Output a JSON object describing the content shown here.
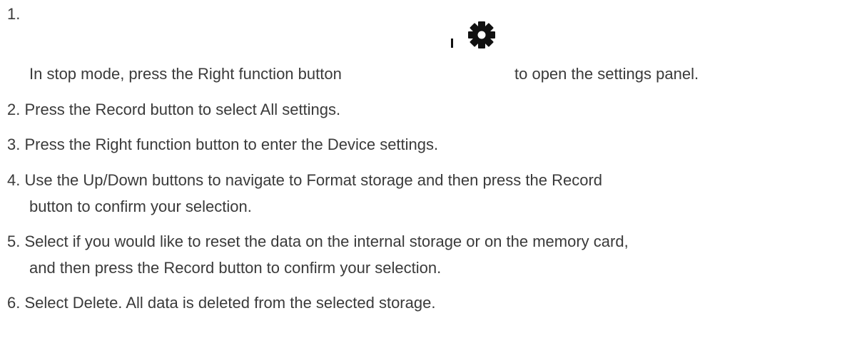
{
  "steps": [
    {
      "number": "1.",
      "text_before_icon": "In stop mode, press the Right function button",
      "icon": "gear-icon",
      "text_after_icon": "to open the settings panel."
    },
    {
      "line1": "2. Press the Record button to select All settings."
    },
    {
      "line1": "3. Press the Right function button to enter the Device settings."
    },
    {
      "line1": "4. Use the Up/Down buttons to navigate to Format storage and then press the Record",
      "line2": "button to confirm your selection."
    },
    {
      "line1": "5. Select if you would like to reset the data on the internal storage or on the memory card,",
      "line2": "and then press the Record button to confirm your selection."
    },
    {
      "line1": "6. Select Delete. All data is deleted from the selected storage."
    }
  ],
  "colors": {
    "text": "#3a3a3a",
    "icon": "#111111",
    "background": "#ffffff"
  }
}
